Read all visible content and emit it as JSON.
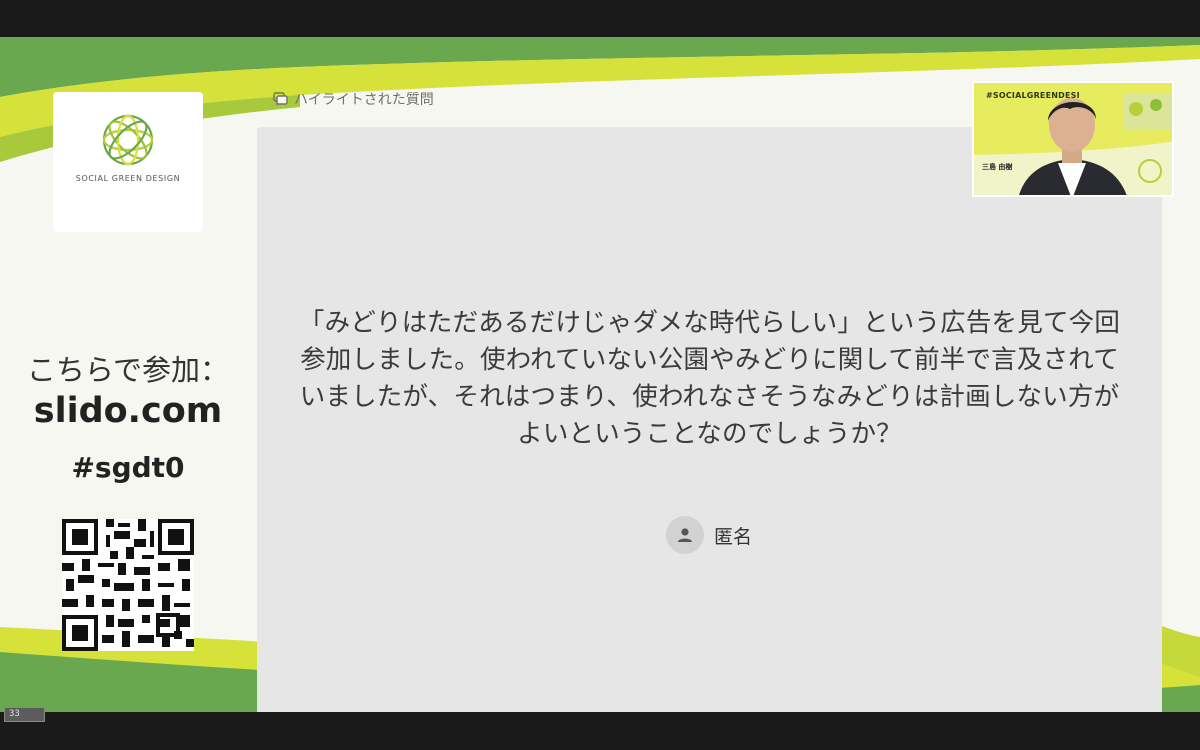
{
  "colors": {
    "brand_green": "#6aa84f",
    "lime": "#d6e23a",
    "dark_green": "#3f7d2a",
    "card_bg": "#e6e6e6"
  },
  "sidebar": {
    "brand_name": "SOCIAL GREEN DESIGN",
    "join_label": "こちらで参加：",
    "site": "slido.com",
    "event_code": "#sgdt0"
  },
  "header": {
    "icon": "highlight-question-icon",
    "label": "ハイライトされた質問"
  },
  "question": {
    "text": "「みどりはただあるだけじゃダメな時代らしい」という広告を見て今回参加しました。使われていない公園やみどりに関して前半で言及されていましたが、それはつまり、使われなさそうなみどりは計画しない方がよいということなのでしょうか？",
    "author": "匿名",
    "author_icon": "user-avatar-icon"
  },
  "video": {
    "hashtag": "#SOCIALGREENDESI",
    "speaker_name": "三島 由樹"
  },
  "slide_counter": "33"
}
